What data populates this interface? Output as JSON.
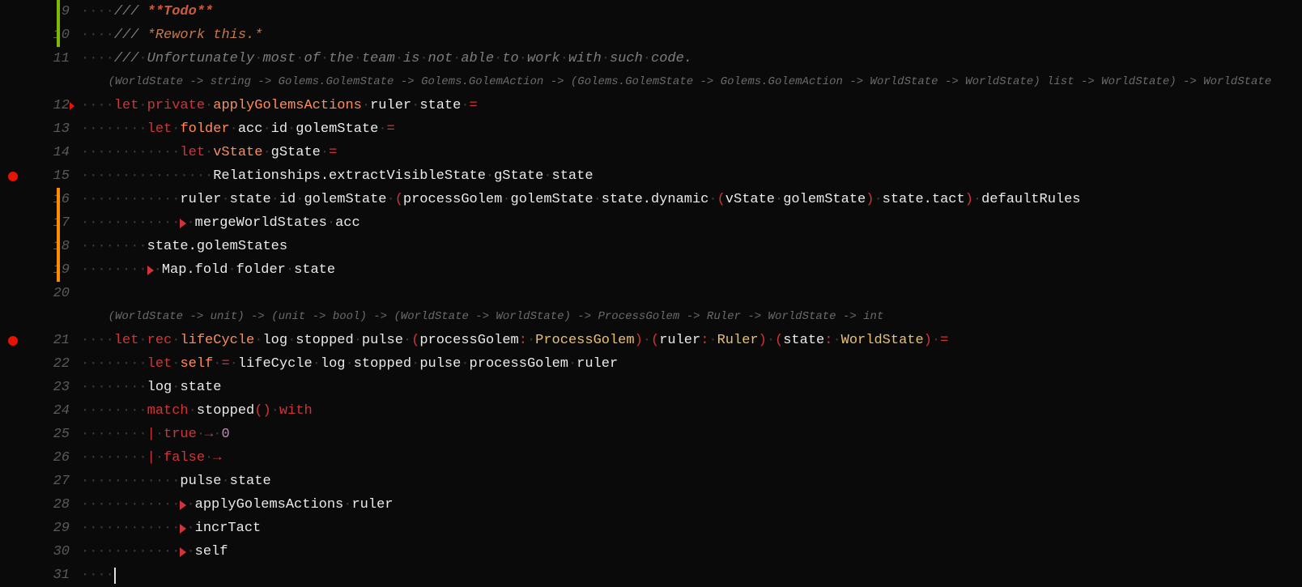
{
  "lines": [
    {
      "n": 9,
      "marker": "green",
      "tokens": [
        {
          "t": "ws",
          "v": "····"
        },
        {
          "t": "comment",
          "v": "/// "
        },
        {
          "t": "comment-b",
          "v": "**Todo**"
        }
      ]
    },
    {
      "n": 10,
      "marker": "green",
      "tokens": [
        {
          "t": "ws",
          "v": "····"
        },
        {
          "t": "comment",
          "v": "/// "
        },
        {
          "t": "comment-i",
          "v": "*Rework this.*"
        }
      ]
    },
    {
      "n": 11,
      "tokens": [
        {
          "t": "ws",
          "v": "····"
        },
        {
          "t": "comment",
          "v": "///"
        },
        {
          "t": "ws",
          "v": "·"
        },
        {
          "t": "comment",
          "v": "Unfortunately"
        },
        {
          "t": "ws",
          "v": "·"
        },
        {
          "t": "comment",
          "v": "most"
        },
        {
          "t": "ws",
          "v": "·"
        },
        {
          "t": "comment",
          "v": "of"
        },
        {
          "t": "ws",
          "v": "·"
        },
        {
          "t": "comment",
          "v": "the"
        },
        {
          "t": "ws",
          "v": "·"
        },
        {
          "t": "comment",
          "v": "team"
        },
        {
          "t": "ws",
          "v": "·"
        },
        {
          "t": "comment",
          "v": "is"
        },
        {
          "t": "ws",
          "v": "·"
        },
        {
          "t": "comment",
          "v": "not"
        },
        {
          "t": "ws",
          "v": "·"
        },
        {
          "t": "comment",
          "v": "able"
        },
        {
          "t": "ws",
          "v": "·"
        },
        {
          "t": "comment",
          "v": "to"
        },
        {
          "t": "ws",
          "v": "·"
        },
        {
          "t": "comment",
          "v": "work"
        },
        {
          "t": "ws",
          "v": "·"
        },
        {
          "t": "comment",
          "v": "with"
        },
        {
          "t": "ws",
          "v": "·"
        },
        {
          "t": "comment",
          "v": "such"
        },
        {
          "t": "ws",
          "v": "·"
        },
        {
          "t": "comment",
          "v": "code."
        }
      ]
    },
    {
      "inlay": true,
      "tokens": [
        {
          "t": "inlay",
          "v": "    (WorldState -> string -> Golems.GolemState -> Golems.GolemAction -> (Golems.GolemState -> Golems.GolemAction -> WorldState -> WorldState) list -> WorldState) -> WorldState"
        }
      ]
    },
    {
      "n": 12,
      "fold": true,
      "tokens": [
        {
          "t": "ws",
          "v": "····"
        },
        {
          "t": "kw",
          "v": "let"
        },
        {
          "t": "ws",
          "v": "·"
        },
        {
          "t": "kw",
          "v": "private"
        },
        {
          "t": "ws",
          "v": "·"
        },
        {
          "t": "kw2",
          "v": "applyGolemsActions"
        },
        {
          "t": "ws",
          "v": "·"
        },
        {
          "t": "id",
          "v": "ruler"
        },
        {
          "t": "ws",
          "v": "·"
        },
        {
          "t": "id",
          "v": "state"
        },
        {
          "t": "ws",
          "v": "·"
        },
        {
          "t": "op",
          "v": "="
        }
      ]
    },
    {
      "n": 13,
      "tokens": [
        {
          "t": "ws",
          "v": "········"
        },
        {
          "t": "kw",
          "v": "let"
        },
        {
          "t": "ws",
          "v": "·"
        },
        {
          "t": "kw2",
          "v": "folder"
        },
        {
          "t": "ws",
          "v": "·"
        },
        {
          "t": "id",
          "v": "acc"
        },
        {
          "t": "ws",
          "v": "·"
        },
        {
          "t": "id",
          "v": "id"
        },
        {
          "t": "ws",
          "v": "·"
        },
        {
          "t": "id",
          "v": "golemState"
        },
        {
          "t": "ws",
          "v": "·"
        },
        {
          "t": "op",
          "v": "="
        }
      ]
    },
    {
      "n": 14,
      "tokens": [
        {
          "t": "ws",
          "v": "············"
        },
        {
          "t": "kw",
          "v": "let"
        },
        {
          "t": "ws",
          "v": "·"
        },
        {
          "t": "kw2",
          "v": "vState"
        },
        {
          "t": "ws",
          "v": "·"
        },
        {
          "t": "id",
          "v": "gState"
        },
        {
          "t": "ws",
          "v": "·"
        },
        {
          "t": "op",
          "v": "="
        }
      ]
    },
    {
      "n": 15,
      "breakpoint": true,
      "tokens": [
        {
          "t": "ws",
          "v": "················"
        },
        {
          "t": "id",
          "v": "Relationships.extractVisibleState"
        },
        {
          "t": "ws",
          "v": "·"
        },
        {
          "t": "id",
          "v": "gState"
        },
        {
          "t": "ws",
          "v": "·"
        },
        {
          "t": "id",
          "v": "state"
        }
      ]
    },
    {
      "n": 16,
      "marker": "orange",
      "tokens": [
        {
          "t": "ws",
          "v": "············"
        },
        {
          "t": "id",
          "v": "ruler"
        },
        {
          "t": "ws",
          "v": "·"
        },
        {
          "t": "id",
          "v": "state"
        },
        {
          "t": "ws",
          "v": "·"
        },
        {
          "t": "id",
          "v": "id"
        },
        {
          "t": "ws",
          "v": "·"
        },
        {
          "t": "id",
          "v": "golemState"
        },
        {
          "t": "ws",
          "v": "·"
        },
        {
          "t": "punc",
          "v": "("
        },
        {
          "t": "id",
          "v": "processGolem"
        },
        {
          "t": "ws",
          "v": "·"
        },
        {
          "t": "id",
          "v": "golemState"
        },
        {
          "t": "ws",
          "v": "·"
        },
        {
          "t": "id",
          "v": "state.dynamic"
        },
        {
          "t": "ws",
          "v": "·"
        },
        {
          "t": "punc",
          "v": "("
        },
        {
          "t": "id",
          "v": "vState"
        },
        {
          "t": "ws",
          "v": "·"
        },
        {
          "t": "id",
          "v": "golemState"
        },
        {
          "t": "punc",
          "v": ")"
        },
        {
          "t": "ws",
          "v": "·"
        },
        {
          "t": "id",
          "v": "state.tact"
        },
        {
          "t": "punc",
          "v": ")"
        },
        {
          "t": "ws",
          "v": "·"
        },
        {
          "t": "id",
          "v": "defaultRules"
        }
      ]
    },
    {
      "n": 17,
      "marker": "orange",
      "tokens": [
        {
          "t": "ws",
          "v": "············"
        },
        {
          "t": "pipe",
          "v": ""
        },
        {
          "t": "ws",
          "v": "·"
        },
        {
          "t": "id",
          "v": "mergeWorldStates"
        },
        {
          "t": "ws",
          "v": "·"
        },
        {
          "t": "id",
          "v": "acc"
        }
      ]
    },
    {
      "n": 18,
      "marker": "orange",
      "tokens": [
        {
          "t": "ws",
          "v": "········"
        },
        {
          "t": "id",
          "v": "state.golemStates"
        }
      ]
    },
    {
      "n": 19,
      "marker": "orange",
      "tokens": [
        {
          "t": "ws",
          "v": "········"
        },
        {
          "t": "pipe",
          "v": ""
        },
        {
          "t": "ws",
          "v": "·"
        },
        {
          "t": "id",
          "v": "Map.fold"
        },
        {
          "t": "ws",
          "v": "·"
        },
        {
          "t": "id",
          "v": "folder"
        },
        {
          "t": "ws",
          "v": "·"
        },
        {
          "t": "id",
          "v": "state"
        }
      ]
    },
    {
      "n": 20,
      "tokens": []
    },
    {
      "inlay": true,
      "tokens": [
        {
          "t": "inlay",
          "v": "    (WorldState -> unit) -> (unit -> bool) -> (WorldState -> WorldState) -> ProcessGolem -> Ruler -> WorldState -> int"
        }
      ]
    },
    {
      "n": 21,
      "breakpoint": true,
      "tokens": [
        {
          "t": "ws",
          "v": "····"
        },
        {
          "t": "kw",
          "v": "let"
        },
        {
          "t": "ws",
          "v": "·"
        },
        {
          "t": "kw",
          "v": "rec"
        },
        {
          "t": "ws",
          "v": "·"
        },
        {
          "t": "kw2",
          "v": "lifeCycle"
        },
        {
          "t": "ws",
          "v": "·"
        },
        {
          "t": "id",
          "v": "log"
        },
        {
          "t": "ws",
          "v": "·"
        },
        {
          "t": "id",
          "v": "stopped"
        },
        {
          "t": "ws",
          "v": "·"
        },
        {
          "t": "id",
          "v": "pulse"
        },
        {
          "t": "ws",
          "v": "·"
        },
        {
          "t": "punc",
          "v": "("
        },
        {
          "t": "id",
          "v": "processGolem"
        },
        {
          "t": "punc",
          "v": ":"
        },
        {
          "t": "ws",
          "v": "·"
        },
        {
          "t": "type",
          "v": "ProcessGolem"
        },
        {
          "t": "punc",
          "v": ")"
        },
        {
          "t": "ws",
          "v": "·"
        },
        {
          "t": "punc",
          "v": "("
        },
        {
          "t": "id",
          "v": "ruler"
        },
        {
          "t": "punc",
          "v": ":"
        },
        {
          "t": "ws",
          "v": "·"
        },
        {
          "t": "type",
          "v": "Ruler"
        },
        {
          "t": "punc",
          "v": ")"
        },
        {
          "t": "ws",
          "v": "·"
        },
        {
          "t": "punc",
          "v": "("
        },
        {
          "t": "id",
          "v": "state"
        },
        {
          "t": "punc",
          "v": ":"
        },
        {
          "t": "ws",
          "v": "·"
        },
        {
          "t": "type",
          "v": "WorldState"
        },
        {
          "t": "punc",
          "v": ")"
        },
        {
          "t": "ws",
          "v": "·"
        },
        {
          "t": "op",
          "v": "="
        }
      ]
    },
    {
      "n": 22,
      "tokens": [
        {
          "t": "ws",
          "v": "········"
        },
        {
          "t": "kw",
          "v": "let"
        },
        {
          "t": "ws",
          "v": "·"
        },
        {
          "t": "kw2",
          "v": "self"
        },
        {
          "t": "ws",
          "v": "·"
        },
        {
          "t": "op",
          "v": "="
        },
        {
          "t": "ws",
          "v": "·"
        },
        {
          "t": "id",
          "v": "lifeCycle"
        },
        {
          "t": "ws",
          "v": "·"
        },
        {
          "t": "id",
          "v": "log"
        },
        {
          "t": "ws",
          "v": "·"
        },
        {
          "t": "id",
          "v": "stopped"
        },
        {
          "t": "ws",
          "v": "·"
        },
        {
          "t": "id",
          "v": "pulse"
        },
        {
          "t": "ws",
          "v": "·"
        },
        {
          "t": "id",
          "v": "processGolem"
        },
        {
          "t": "ws",
          "v": "·"
        },
        {
          "t": "id",
          "v": "ruler"
        }
      ]
    },
    {
      "n": 23,
      "tokens": [
        {
          "t": "ws",
          "v": "········"
        },
        {
          "t": "id",
          "v": "log"
        },
        {
          "t": "ws",
          "v": "·"
        },
        {
          "t": "id",
          "v": "state"
        }
      ]
    },
    {
      "n": 24,
      "tokens": [
        {
          "t": "ws",
          "v": "········"
        },
        {
          "t": "kw",
          "v": "match"
        },
        {
          "t": "ws",
          "v": "·"
        },
        {
          "t": "id",
          "v": "stopped"
        },
        {
          "t": "punc",
          "v": "()"
        },
        {
          "t": "ws",
          "v": "·"
        },
        {
          "t": "kw",
          "v": "with"
        }
      ]
    },
    {
      "n": 25,
      "tokens": [
        {
          "t": "ws",
          "v": "········"
        },
        {
          "t": "op",
          "v": "|"
        },
        {
          "t": "ws",
          "v": "·"
        },
        {
          "t": "kw",
          "v": "true"
        },
        {
          "t": "ws",
          "v": "·"
        },
        {
          "t": "op",
          "v": "→"
        },
        {
          "t": "ws",
          "v": "·"
        },
        {
          "t": "num",
          "v": "0"
        }
      ]
    },
    {
      "n": 26,
      "tokens": [
        {
          "t": "ws",
          "v": "········"
        },
        {
          "t": "op",
          "v": "|"
        },
        {
          "t": "ws",
          "v": "·"
        },
        {
          "t": "kw",
          "v": "false"
        },
        {
          "t": "ws",
          "v": "·"
        },
        {
          "t": "op",
          "v": "→"
        }
      ]
    },
    {
      "n": 27,
      "tokens": [
        {
          "t": "ws",
          "v": "············"
        },
        {
          "t": "id",
          "v": "pulse"
        },
        {
          "t": "ws",
          "v": "·"
        },
        {
          "t": "id",
          "v": "state"
        }
      ]
    },
    {
      "n": 28,
      "tokens": [
        {
          "t": "ws",
          "v": "············"
        },
        {
          "t": "pipe",
          "v": ""
        },
        {
          "t": "ws",
          "v": "·"
        },
        {
          "t": "id",
          "v": "applyGolemsActions"
        },
        {
          "t": "ws",
          "v": "·"
        },
        {
          "t": "id",
          "v": "ruler"
        }
      ]
    },
    {
      "n": 29,
      "tokens": [
        {
          "t": "ws",
          "v": "············"
        },
        {
          "t": "pipe",
          "v": ""
        },
        {
          "t": "ws",
          "v": "·"
        },
        {
          "t": "id",
          "v": "incrTact"
        }
      ]
    },
    {
      "n": 30,
      "tokens": [
        {
          "t": "ws",
          "v": "············"
        },
        {
          "t": "pipe",
          "v": ""
        },
        {
          "t": "ws",
          "v": "·"
        },
        {
          "t": "id",
          "v": "self"
        }
      ]
    },
    {
      "n": 31,
      "cursor": true,
      "tokens": [
        {
          "t": "ws",
          "v": "····"
        }
      ]
    }
  ]
}
